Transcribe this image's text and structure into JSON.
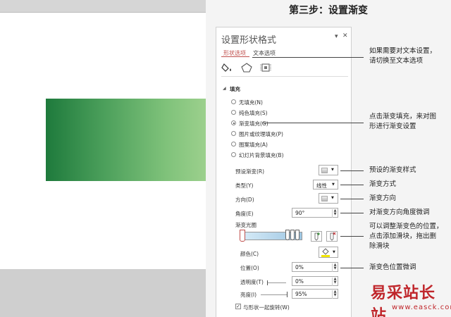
{
  "step_title": "第三步：设置渐变",
  "panel": {
    "title": "设置形状格式",
    "pin_icon": "▾",
    "close_icon": "✕",
    "tabs": [
      "形状选项",
      "文本选项"
    ],
    "section_title": "填充",
    "fill_options": [
      {
        "label": "无填充(N)",
        "selected": false
      },
      {
        "label": "纯色填充(S)",
        "selected": false
      },
      {
        "label": "渐变填充(G)",
        "selected": true
      },
      {
        "label": "图片或纹理填充(P)",
        "selected": false
      },
      {
        "label": "图案填充(A)",
        "selected": false
      },
      {
        "label": "幻灯片背景填充(B)",
        "selected": false
      }
    ],
    "preset_label": "预设渐变(R)",
    "type_label": "类型(Y)",
    "type_value": "线性",
    "direction_label": "方向(D)",
    "angle_label": "角度(E)",
    "angle_value": "90°",
    "gradient_stops_label": "渐变光圈",
    "color_label": "颜色(C)",
    "position_label": "位置(O)",
    "position_value": "0%",
    "transparency_label": "透明度(T)",
    "transparency_value": "0%",
    "brightness_label": "亮度(I)",
    "brightness_value": "95%",
    "rotate_label": "与形状一起旋转(W)"
  },
  "annotations": {
    "text_options": [
      "如果需要对文本设置，",
      "请切换至文本选项"
    ],
    "gradient_fill": [
      "点击渐变填充，来对图",
      "形进行渐变设置"
    ],
    "preset": "预设的渐变样式",
    "type": "渐变方式",
    "direction": "渐变方向",
    "angle": "对渐变方向角度微调",
    "stops": [
      "可以调整渐变色的位置，",
      "点击添加滑块，拖出删",
      "除滑块"
    ],
    "position": "渐变色位置微调"
  },
  "watermark": {
    "main": "易采站长站",
    "url": "www.easck.com"
  },
  "colors": {
    "gradient_start": "#1e7a3c",
    "gradient_end": "#9cd08d",
    "panel_title": "#555555",
    "watermark": "#c0262b"
  }
}
